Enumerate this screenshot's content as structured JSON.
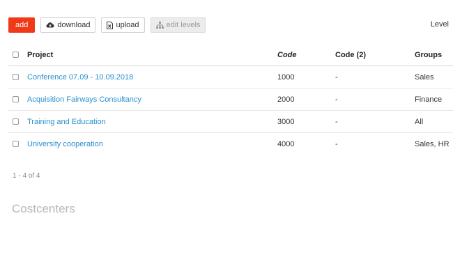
{
  "toolbar": {
    "add_label": "add",
    "download_label": "download",
    "upload_label": "upload",
    "edit_levels_label": "edit levels",
    "add_color": "#f03a17"
  },
  "level_label": "Level",
  "table": {
    "headers": {
      "project": "Project",
      "code": "Code",
      "code2": "Code (2)",
      "groups": "Groups"
    },
    "rows": [
      {
        "project": "Conference 07.09 - 10.09.2018",
        "code": "1000",
        "code2": "-",
        "groups": "Sales"
      },
      {
        "project": "Acquisition Fairways Consultancy",
        "code": "2000",
        "code2": "-",
        "groups": "Finance"
      },
      {
        "project": "Training and Education",
        "code": "3000",
        "code2": "-",
        "groups": "All"
      },
      {
        "project": "University cooperation",
        "code": "4000",
        "code2": "-",
        "groups": "Sales, HR"
      }
    ],
    "link_color": "#2a8fce"
  },
  "pager": "1 - 4 of 4",
  "section_title": "Costcenters",
  "icons": {
    "download": "cloud-download-icon",
    "upload": "excel-file-icon",
    "edit_levels": "sitemap-icon"
  }
}
